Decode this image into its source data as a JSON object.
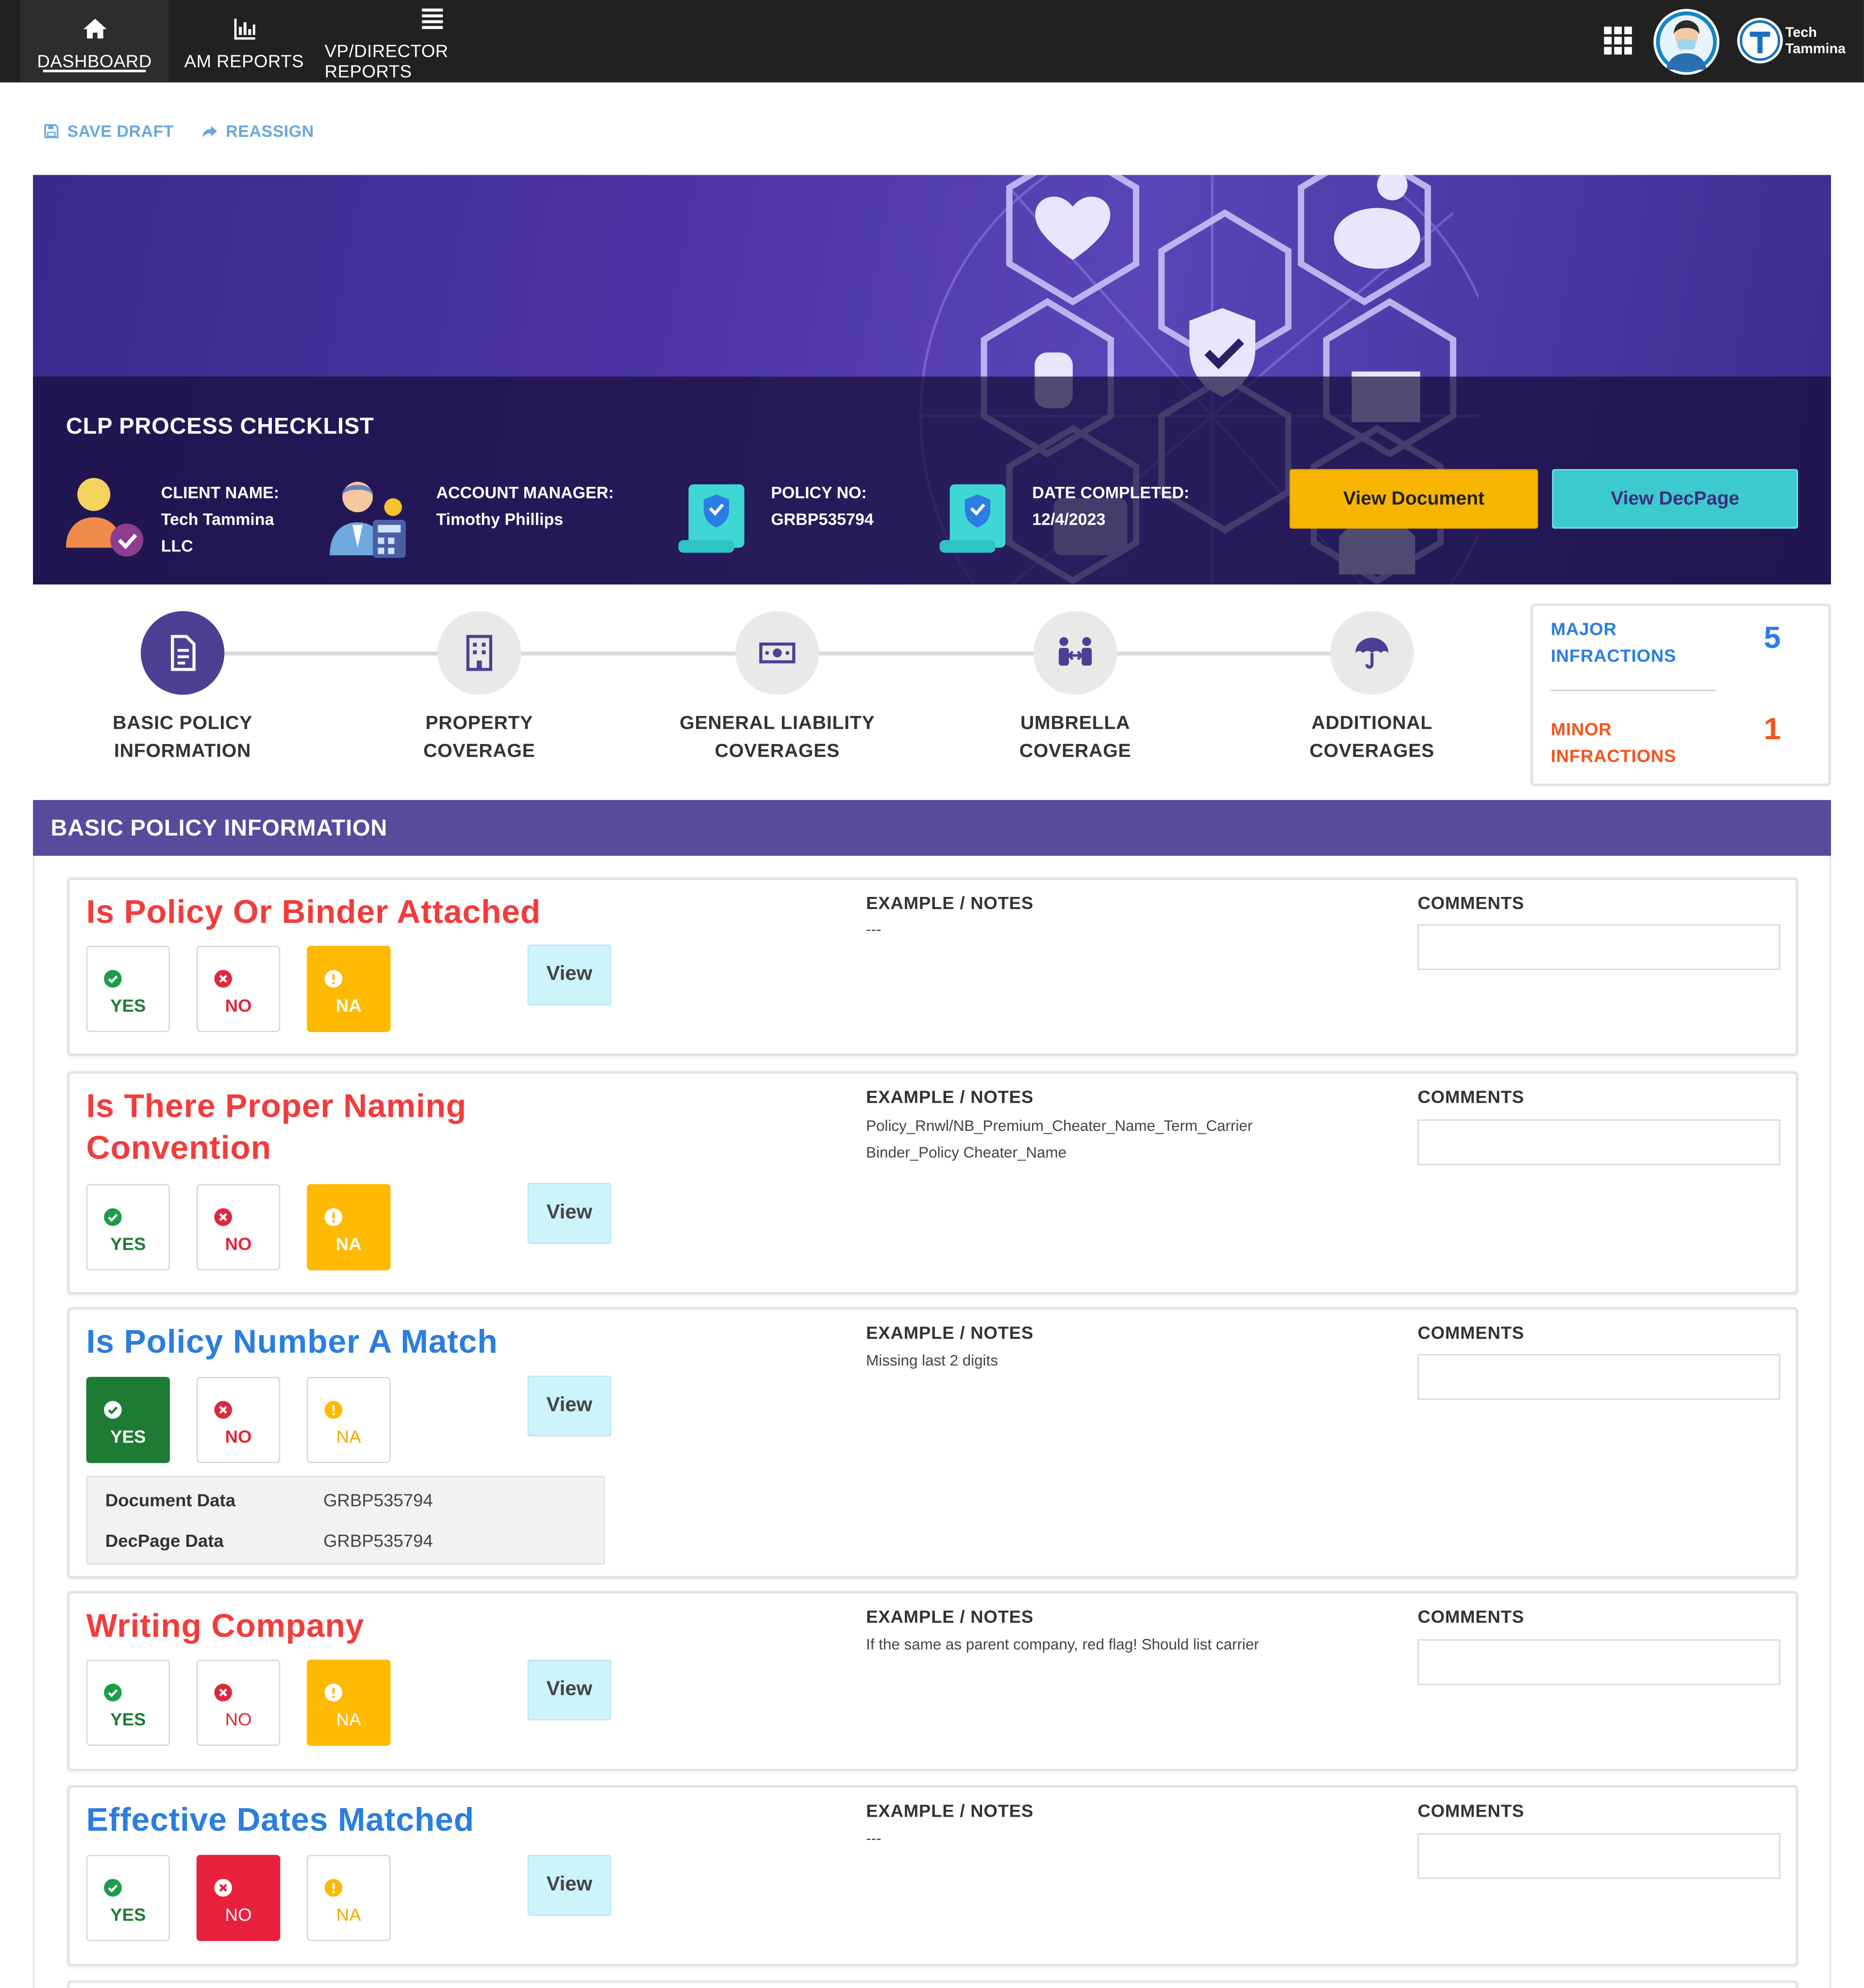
{
  "nav": {
    "items": [
      {
        "label": "DASHBOARD",
        "icon": "home-icon",
        "active": true
      },
      {
        "label": "AM REPORTS",
        "icon": "bar-chart-icon",
        "active": false
      },
      {
        "label": "VP/DIRECTOR REPORTS",
        "icon": "menu-icon",
        "active": false
      }
    ],
    "logo": {
      "line1": "Tech",
      "line2": "Tammina"
    }
  },
  "actions": {
    "save_draft": "SAVE DRAFT",
    "reassign": "REASSIGN"
  },
  "banner": {
    "title": "CLP PROCESS CHECKLIST",
    "client": {
      "label": "CLIENT NAME:",
      "value_line1": "Tech Tammina",
      "value_line2": "LLC"
    },
    "manager": {
      "label": "ACCOUNT MANAGER:",
      "value": "Timothy Phillips"
    },
    "policy": {
      "label": "POLICY NO:",
      "value": "GRBP535794"
    },
    "date": {
      "label": "DATE COMPLETED:",
      "value": "12/4/2023"
    },
    "view_document": "View Document",
    "view_decpage": "View DecPage"
  },
  "steps": [
    {
      "line1": "BASIC POLICY",
      "line2": "INFORMATION",
      "icon": "document-icon",
      "active": true
    },
    {
      "line1": "PROPERTY",
      "line2": "COVERAGE",
      "icon": "building-icon",
      "active": false
    },
    {
      "line1": "GENERAL LIABILITY",
      "line2": "COVERAGES",
      "icon": "money-icon",
      "active": false
    },
    {
      "line1": "UMBRELLA",
      "line2": "COVERAGE",
      "icon": "people-exchange-icon",
      "active": false
    },
    {
      "line1": "ADDITIONAL",
      "line2": "COVERAGES",
      "icon": "umbrella-icon",
      "active": false
    }
  ],
  "infractions": {
    "major": {
      "line1": "MAJOR",
      "line2": "INFRACTIONS",
      "count": "5",
      "color": "#2a7de1"
    },
    "minor": {
      "line1": "MINOR",
      "line2": "INFRACTIONS",
      "count": "1",
      "color": "#f5541e"
    }
  },
  "section": {
    "title": "BASIC POLICY INFORMATION"
  },
  "common": {
    "yes": "YES",
    "no": "NO",
    "na": "NA",
    "view": "View",
    "notes_label": "EXAMPLE / NOTES",
    "comments_label": "COMMENTS"
  },
  "questions": [
    {
      "title": "Is Policy Or Binder Attached",
      "status": "infraction",
      "selected": "NA",
      "notes": [
        "---"
      ]
    },
    {
      "title_line1": "Is There Proper Naming",
      "title_line2": "Convention",
      "status": "infraction",
      "selected": "NA",
      "notes": [
        "Policy_Rnwl/NB_Premium_Cheater_Name_Term_Carrier",
        "Binder_Policy Cheater_Name"
      ]
    },
    {
      "title": "Is Policy Number A Match",
      "status": "ok",
      "selected": "YES",
      "notes": [
        "Missing last 2 digits"
      ],
      "data": {
        "doc_label": "Document Data",
        "doc_value": "GRBP535794",
        "dec_label": "DecPage Data",
        "dec_value": "GRBP535794"
      }
    },
    {
      "title": "Writing Company",
      "status": "infraction",
      "selected": "NA",
      "notes": [
        "If the same as parent company, red flag! Should list carrier"
      ]
    },
    {
      "title": "Effective Dates Matched",
      "status": "ok",
      "selected": "NO",
      "notes": [
        "---"
      ]
    }
  ]
}
